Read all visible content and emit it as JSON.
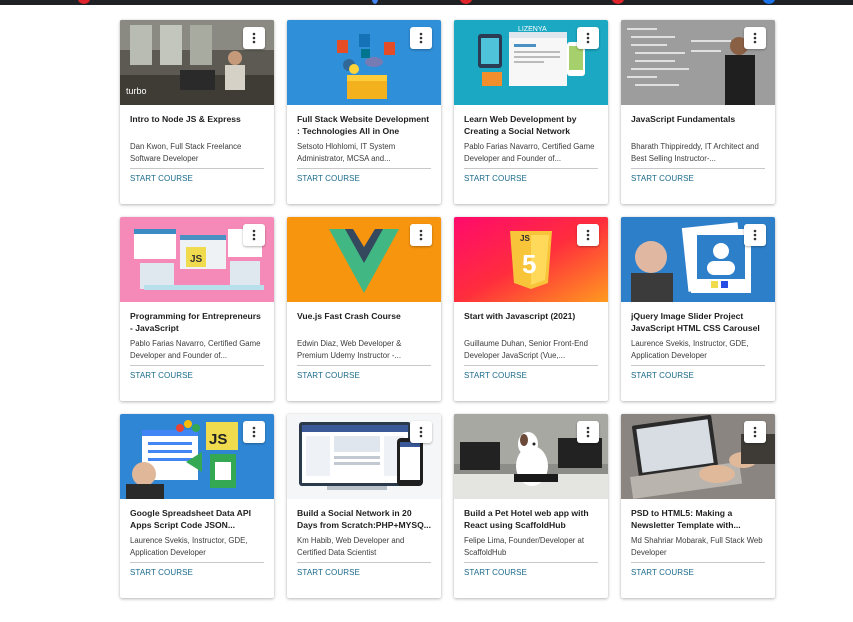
{
  "top_bar": {
    "colors": [
      "#e0242b",
      "#4285f4",
      "#e0242b",
      "#e0242b",
      "#1a73e8"
    ]
  },
  "cards": [
    {
      "title": "Intro to Node JS & Express",
      "author": "Dan Kwon, Full Stack Freelance Software Developer",
      "cta": "START COURSE",
      "logo_text": "turbo"
    },
    {
      "title": "Full Stack Website Development : Technologies All in One",
      "author": "Setsoto Hlohlomi, IT System Administrator, MCSA and...",
      "cta": "START COURSE"
    },
    {
      "title": "Learn Web Development by Creating a Social Network",
      "author": "Pablo Farias Navarro, Certified Game Developer and Founder of...",
      "cta": "START COURSE",
      "logo_text": "LIZENYA"
    },
    {
      "title": "JavaScript Fundamentals",
      "author": "Bharath Thippireddy, IT Architect and Best Selling Instructor-...",
      "cta": "START COURSE"
    },
    {
      "title": "Programming for Entrepreneurs - JavaScript",
      "author": "Pablo Farias Navarro, Certified Game Developer and Founder of...",
      "cta": "START COURSE",
      "logo_text": "JS"
    },
    {
      "title": "Vue.js Fast Crash Course",
      "author": "Edwin Diaz, Web Developer & Premium Udemy Instructor -...",
      "cta": "START COURSE"
    },
    {
      "title": "Start with Javascript (2021)",
      "author": "Guillaume Duhan, Senior Front-End Developer JavaScript (Vue,...",
      "cta": "START COURSE",
      "logo_text": "JS"
    },
    {
      "title": "jQuery Image Slider Project JavaScript HTML CSS Carousel",
      "author": "Laurence Svekis, Instructor, GDE, Application Developer",
      "cta": "START COURSE"
    },
    {
      "title": "Google Spreadsheet Data API Apps Script Code JSON...",
      "author": "Laurence Svekis, Instructor, GDE, Application Developer",
      "cta": "START COURSE",
      "logo_text": "JS"
    },
    {
      "title": "Build a Social Network in 20 Days from Scratch:PHP+MYSQ...",
      "author": "Km Habib, Web Developer and Certified Data Scientist",
      "cta": "START COURSE"
    },
    {
      "title": "Build a Pet Hotel web app with React using ScaffoldHub",
      "author": "Felipe Lima, Founder/Developer at ScaffoldHub",
      "cta": "START COURSE"
    },
    {
      "title": "PSD to HTML5: Making a Newsletter Template with...",
      "author": "Md Shahriar Mobarak, Full Stack Web Developer",
      "cta": "START COURSE"
    }
  ]
}
